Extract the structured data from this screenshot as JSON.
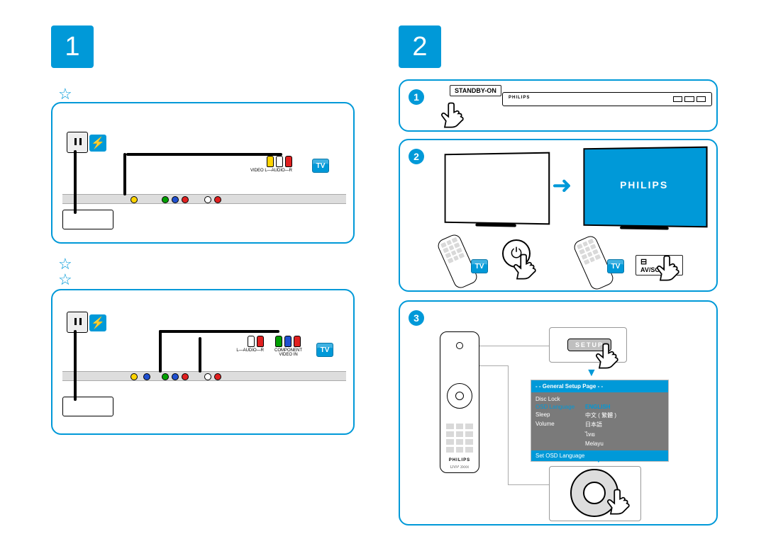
{
  "steps": {
    "one_badge": "1",
    "two_badge": "2",
    "sub1": "1",
    "sub2": "2",
    "sub3": "3"
  },
  "labels": {
    "standby_on": "STANDBY-ON",
    "av_source": "AV/SOURCE",
    "tv": "TV",
    "setup": "SETUP",
    "brand": "PHILIPS",
    "video_in_audio": "VIDEO   L—AUDIO—R",
    "audio_lr": "L—AUDIO—R",
    "component_video_in": "COMPONENT\nVIDEO IN",
    "remote_model": "DVP 3xxx"
  },
  "osd": {
    "header": "- - General Setup Page - -",
    "rows": [
      {
        "c1": "Disc Lock",
        "c2": ""
      },
      {
        "c1": "OSD Language",
        "c2": "ENGLISH",
        "highlight": true
      },
      {
        "c1": "Sleep",
        "c2": "中文 ( 繁體 )"
      },
      {
        "c1": "Volume",
        "c2": "日本語"
      },
      {
        "c1": "",
        "c2": "ไทย"
      },
      {
        "c1": "",
        "c2": "Melayu"
      }
    ],
    "footer": "Set OSD Language"
  }
}
